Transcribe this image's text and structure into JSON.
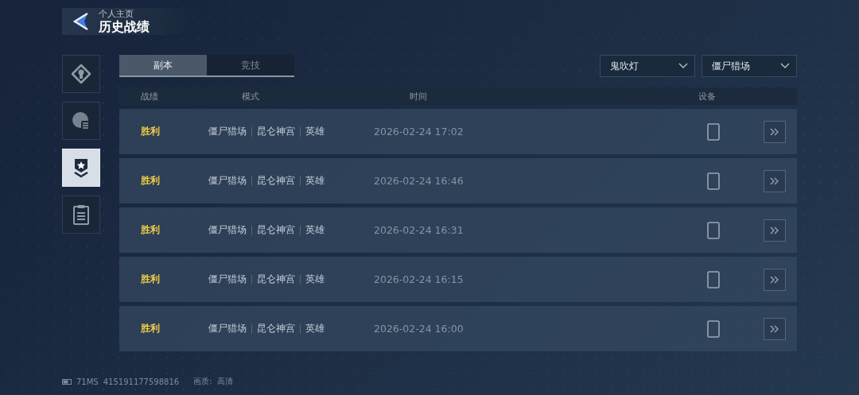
{
  "header": {
    "subtitle": "个人主页",
    "title": "历史战绩"
  },
  "sidebar": {
    "items": [
      {
        "selected": false
      },
      {
        "selected": false
      },
      {
        "selected": true
      },
      {
        "selected": false
      }
    ]
  },
  "tabs": [
    {
      "label": "副本",
      "selected": true
    },
    {
      "label": "竞技",
      "selected": false
    }
  ],
  "filters": [
    {
      "value": "鬼吹灯"
    },
    {
      "value": "僵尸猎场"
    }
  ],
  "table": {
    "columns": [
      "战绩",
      "模式",
      "时间",
      "设备"
    ],
    "rows": [
      {
        "result": "胜利",
        "win": true,
        "mode": [
          "僵尸猎场",
          "昆仑神宫",
          "英雄"
        ],
        "time": "2026-02-24 17:02"
      },
      {
        "result": "胜利",
        "win": true,
        "mode": [
          "僵尸猎场",
          "昆仑神宫",
          "英雄"
        ],
        "time": "2026-02-24 16:46"
      },
      {
        "result": "胜利",
        "win": true,
        "mode": [
          "僵尸猎场",
          "昆仑神宫",
          "英雄"
        ],
        "time": "2026-02-24 16:31"
      },
      {
        "result": "胜利",
        "win": true,
        "mode": [
          "僵尸猎场",
          "昆仑神宫",
          "英雄"
        ],
        "time": "2026-02-24 16:15"
      },
      {
        "result": "胜利",
        "win": true,
        "mode": [
          "僵尸猎场",
          "昆仑神宫",
          "英雄"
        ],
        "time": "2026-02-24 16:00"
      }
    ]
  },
  "status_bar": {
    "ping": "71MS",
    "uid": "415191177598816",
    "quality_label": "画质:",
    "quality": "高清"
  }
}
